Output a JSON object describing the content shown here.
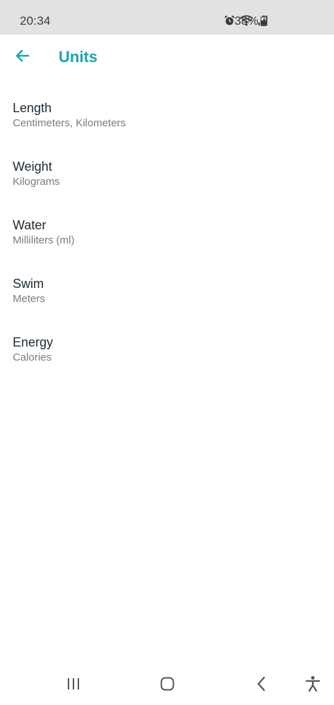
{
  "status_bar": {
    "time": "20:34",
    "battery": "38%",
    "icons": [
      "alarm-icon",
      "wifi-icon",
      "signal-icon",
      "battery-icon"
    ]
  },
  "app_bar": {
    "title": "Units",
    "back_icon": "arrow-left-icon"
  },
  "units": [
    {
      "label": "Length",
      "value": "Centimeters, Kilometers"
    },
    {
      "label": "Weight",
      "value": "Kilograms"
    },
    {
      "label": "Water",
      "value": "Milliliters (ml)"
    },
    {
      "label": "Swim",
      "value": "Meters"
    },
    {
      "label": "Energy",
      "value": "Calories"
    }
  ],
  "nav_bar": {
    "buttons": [
      "recent-apps-icon",
      "home-icon",
      "back-icon",
      "accessibility-icon"
    ]
  },
  "colors": {
    "accent": "#16a4b0",
    "status_bar_bg": "#e2e2e2",
    "primary_text": "#1c2a33",
    "secondary_text": "#7b7b7b"
  }
}
